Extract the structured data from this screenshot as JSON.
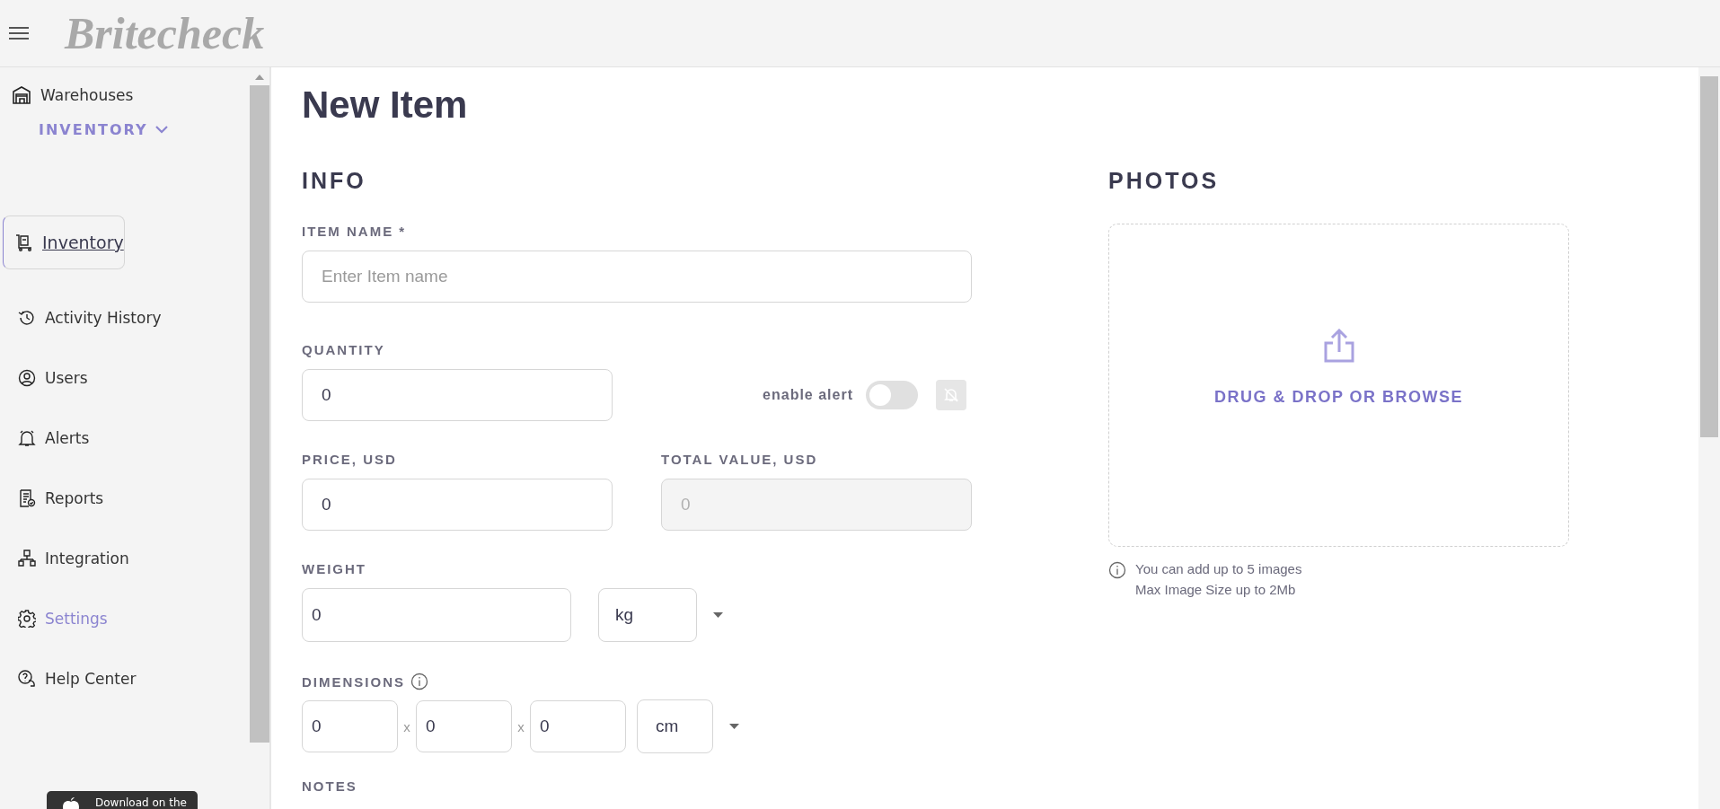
{
  "header": {
    "logo": "Britecheck"
  },
  "sidebar": {
    "warehouse_link": "Warehouses",
    "section": "INVENTORY",
    "items": [
      {
        "label": "Inventory",
        "kind": "cart",
        "selected": true,
        "hovered": false
      },
      {
        "label": "Activity History",
        "kind": "history",
        "selected": false,
        "hovered": false
      },
      {
        "label": "Users",
        "kind": "user",
        "selected": false,
        "hovered": false
      },
      {
        "label": "Alerts",
        "kind": "bell",
        "selected": false,
        "hovered": false
      },
      {
        "label": "Reports",
        "kind": "report",
        "selected": false,
        "hovered": false
      },
      {
        "label": "Integration",
        "kind": "network",
        "selected": false,
        "hovered": false
      },
      {
        "label": "Settings",
        "kind": "gear",
        "selected": false,
        "hovered": true
      },
      {
        "label": "Help Center",
        "kind": "help",
        "selected": false,
        "hovered": false
      }
    ],
    "app_store_badge": "Download on the"
  },
  "page": {
    "title": "New Item"
  },
  "info": {
    "heading": "INFO",
    "item_name": {
      "label": "ITEM NAME *",
      "placeholder": "Enter Item name"
    },
    "quantity": {
      "label": "QUANTITY",
      "value": "0"
    },
    "alert": {
      "label": "enable alert",
      "on": false
    },
    "price": {
      "label": "PRICE, USD",
      "value": "0"
    },
    "total_value": {
      "label": "TOTAL VALUE, USD",
      "value": "0",
      "disabled": true
    },
    "weight": {
      "label": "WEIGHT",
      "value": "0",
      "unit": "kg"
    },
    "dimensions": {
      "label": "DIMENSIONS",
      "values": [
        "0",
        "0",
        "0"
      ],
      "separators": [
        "x",
        "x"
      ],
      "unit": "cm"
    },
    "notes": {
      "label": "NOTES"
    }
  },
  "photos": {
    "heading": "PHOTOS",
    "dropzone": "DRUG & DROP OR BROWSE",
    "hints": [
      "You can add up to 5 images",
      "Max Image Size up to 2Mb"
    ]
  }
}
